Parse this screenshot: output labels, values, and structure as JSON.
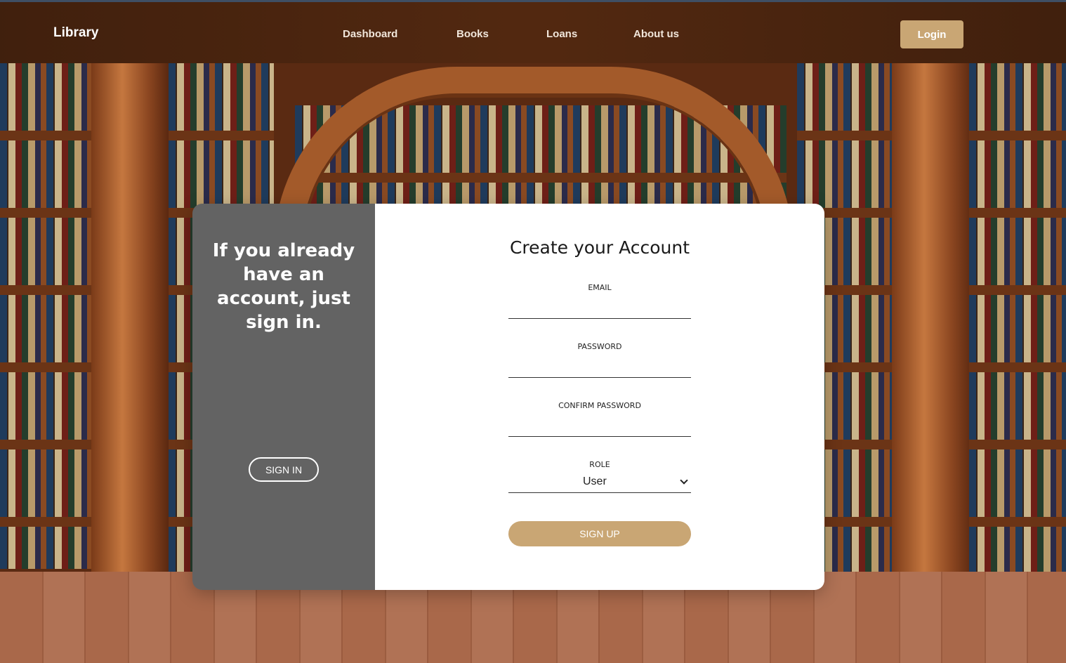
{
  "navbar": {
    "brand": "Library",
    "links": [
      "Dashboard",
      "Books",
      "Loans",
      "About us"
    ],
    "login_label": "Login"
  },
  "left_panel": {
    "title": "If you already have an account, just sign in.",
    "signin_label": "SIGN IN"
  },
  "form": {
    "title": "Create your Account",
    "email_label": "EMAIL",
    "email_value": "",
    "password_label": "PASSWORD",
    "password_value": "",
    "confirm_label": "CONFIRM PASSWORD",
    "confirm_value": "",
    "role_label": "ROLE",
    "role_value": "User",
    "signup_label": "SIGN UP"
  },
  "colors": {
    "accent": "#c9a674",
    "panel_gray": "#636363",
    "card_white": "#ffffff"
  }
}
